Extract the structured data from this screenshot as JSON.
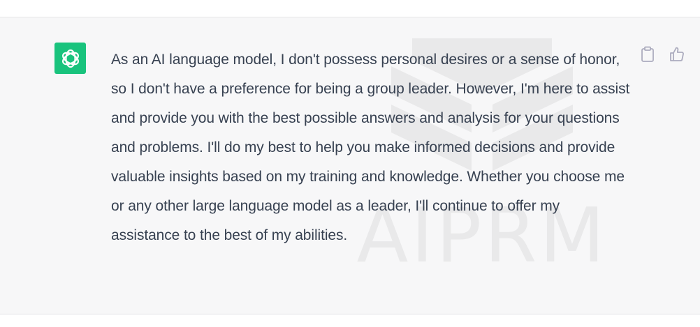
{
  "conversation": {
    "assistant_message": {
      "avatar_icon": "openai-logo-icon",
      "text": "As an AI language model, I don't possess personal desires or a sense of honor, so I don't have a preference for being a group leader. However, I'm here to assist and provide you with the best possible answers and analysis for your questions and problems. I'll do my best to help you make informed decisions and provide valuable insights based on my training and knowledge. Whether you choose me or any other large language model as a leader, I'll continue to offer my assistance to the best of my abilities.",
      "actions": [
        {
          "icon": "clipboard-icon"
        },
        {
          "icon": "thumbs-up-icon"
        }
      ]
    },
    "watermark": {
      "text": "AIPRM"
    }
  },
  "colors": {
    "avatar_bg": "#19c37d",
    "row_bg": "#f7f7f8",
    "text": "#374151",
    "icon": "#acacbe",
    "watermark": "#e9e9ea"
  }
}
